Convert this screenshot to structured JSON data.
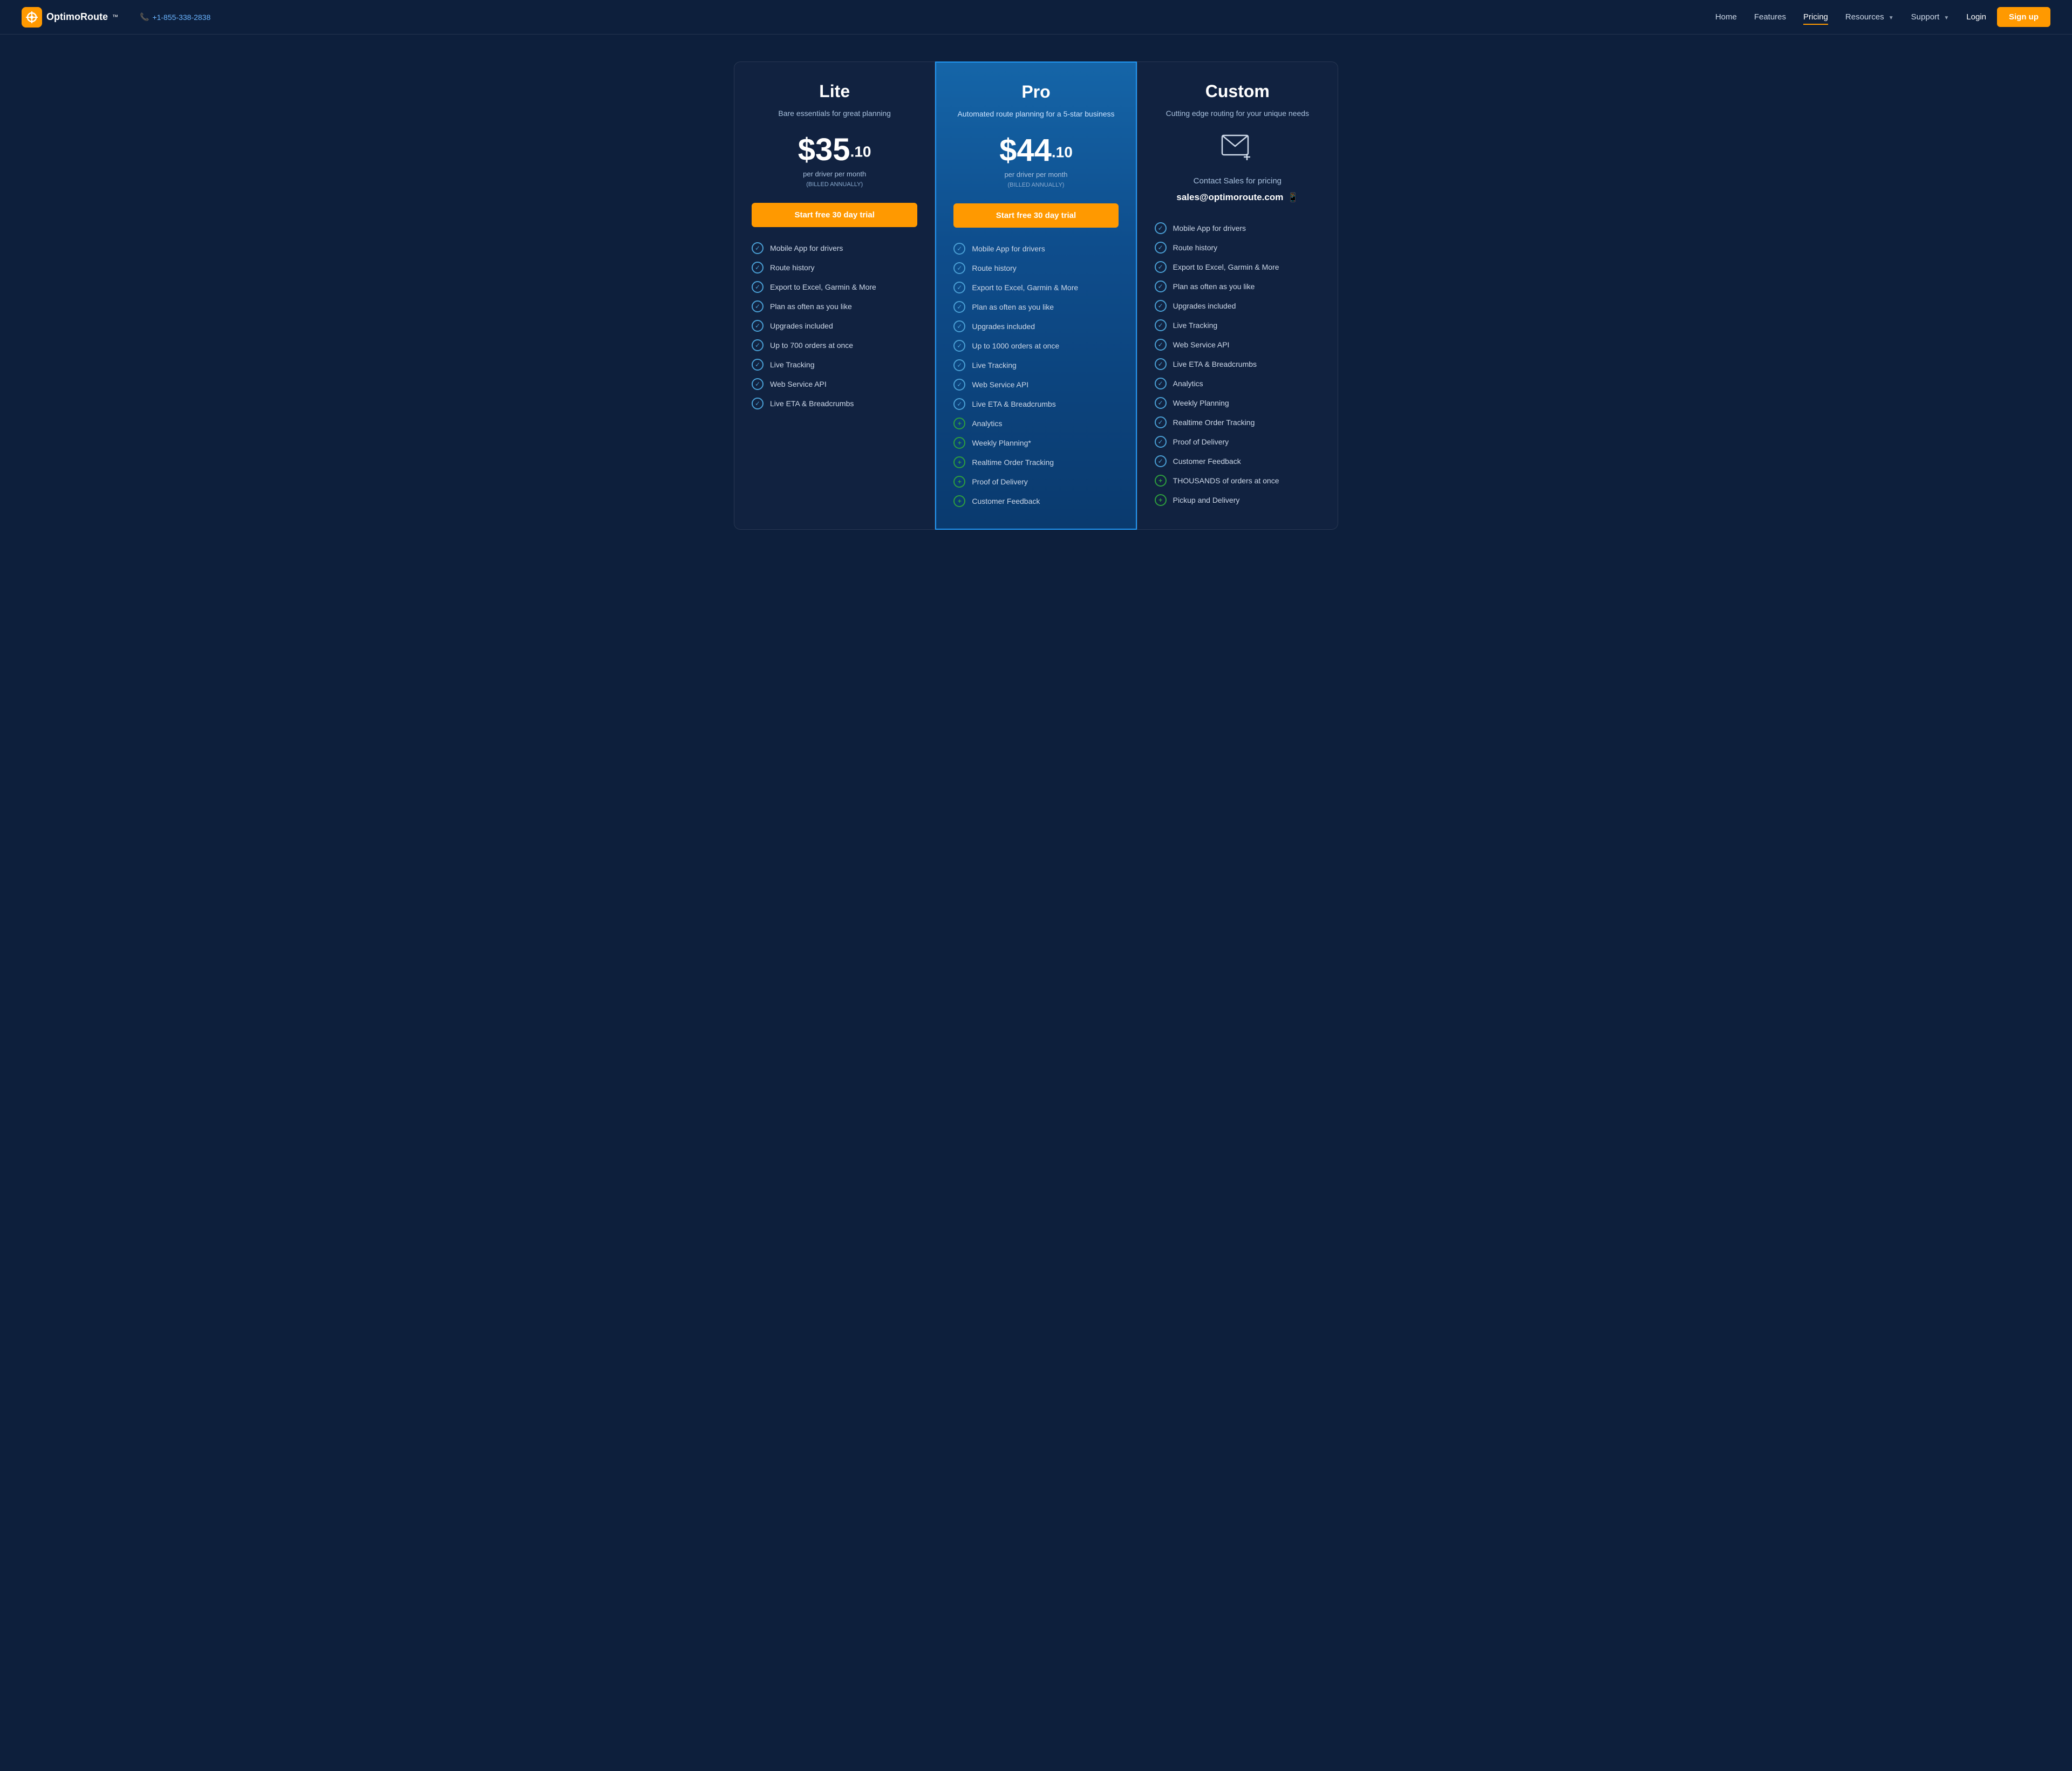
{
  "brand": {
    "name": "OptimoRoute",
    "trademark": "™",
    "phone": "+1-855-338-2838"
  },
  "navbar": {
    "links": [
      {
        "id": "home",
        "label": "Home",
        "active": false
      },
      {
        "id": "features",
        "label": "Features",
        "active": false
      },
      {
        "id": "pricing",
        "label": "Pricing",
        "active": true
      },
      {
        "id": "resources",
        "label": "Resources",
        "active": false,
        "dropdown": true
      },
      {
        "id": "support",
        "label": "Support",
        "active": false,
        "dropdown": true
      }
    ],
    "login_label": "Login",
    "signup_label": "Sign up"
  },
  "plans": [
    {
      "id": "lite",
      "name": "Lite",
      "desc": "Bare essentials for great planning",
      "price_main": "$35",
      "price_cents": ".10",
      "price_period": "per driver per month",
      "price_billed": "(BILLED ANNUALLY)",
      "cta": "Start free 30 day trial",
      "features": [
        {
          "label": "Mobile App for drivers",
          "type": "check"
        },
        {
          "label": "Route history",
          "type": "check"
        },
        {
          "label": "Export to Excel, Garmin & More",
          "type": "check"
        },
        {
          "label": "Plan as often as you like",
          "type": "check"
        },
        {
          "label": "Upgrades included",
          "type": "check"
        },
        {
          "label": "Up to 700 orders at once",
          "type": "check"
        },
        {
          "label": "Live Tracking",
          "type": "check"
        },
        {
          "label": "Web Service API",
          "type": "check"
        },
        {
          "label": "Live ETA & Breadcrumbs",
          "type": "check"
        }
      ]
    },
    {
      "id": "pro",
      "name": "Pro",
      "desc": "Automated route planning for a 5-star business",
      "price_main": "$44",
      "price_cents": ".10",
      "price_period": "per driver per month",
      "price_billed": "(BILLED ANNUALLY)",
      "cta": "Start free 30 day trial",
      "features": [
        {
          "label": "Mobile App for drivers",
          "type": "check"
        },
        {
          "label": "Route history",
          "type": "check"
        },
        {
          "label": "Export to Excel, Garmin & More",
          "type": "check"
        },
        {
          "label": "Plan as often as you like",
          "type": "check"
        },
        {
          "label": "Upgrades included",
          "type": "check"
        },
        {
          "label": "Up to 1000 orders at once",
          "type": "check"
        },
        {
          "label": "Live Tracking",
          "type": "check"
        },
        {
          "label": "Web Service API",
          "type": "check"
        },
        {
          "label": "Live ETA & Breadcrumbs",
          "type": "check"
        },
        {
          "label": "Analytics",
          "type": "plus"
        },
        {
          "label": "Weekly Planning*",
          "type": "plus"
        },
        {
          "label": "Realtime Order Tracking",
          "type": "plus"
        },
        {
          "label": "Proof of Delivery",
          "type": "plus"
        },
        {
          "label": "Customer Feedback",
          "type": "plus"
        }
      ]
    },
    {
      "id": "custom",
      "name": "Custom",
      "desc": "Cutting edge routing for your unique needs",
      "contact_text": "Contact Sales for pricing",
      "contact_email": "sales@optimoroute.com",
      "features": [
        {
          "label": "Mobile App for drivers",
          "type": "check"
        },
        {
          "label": "Route history",
          "type": "check"
        },
        {
          "label": "Export to Excel, Garmin & More",
          "type": "check"
        },
        {
          "label": "Plan as often as you like",
          "type": "check"
        },
        {
          "label": "Upgrades included",
          "type": "check"
        },
        {
          "label": "Live Tracking",
          "type": "check"
        },
        {
          "label": "Web Service API",
          "type": "check"
        },
        {
          "label": "Live ETA & Breadcrumbs",
          "type": "check"
        },
        {
          "label": "Analytics",
          "type": "check"
        },
        {
          "label": "Weekly Planning",
          "type": "check"
        },
        {
          "label": "Realtime Order Tracking",
          "type": "check"
        },
        {
          "label": "Proof of Delivery",
          "type": "check"
        },
        {
          "label": "Customer Feedback",
          "type": "check"
        },
        {
          "label": "THOUSANDS of orders at once",
          "type": "plus"
        },
        {
          "label": "Pickup and Delivery",
          "type": "plus"
        }
      ]
    }
  ]
}
